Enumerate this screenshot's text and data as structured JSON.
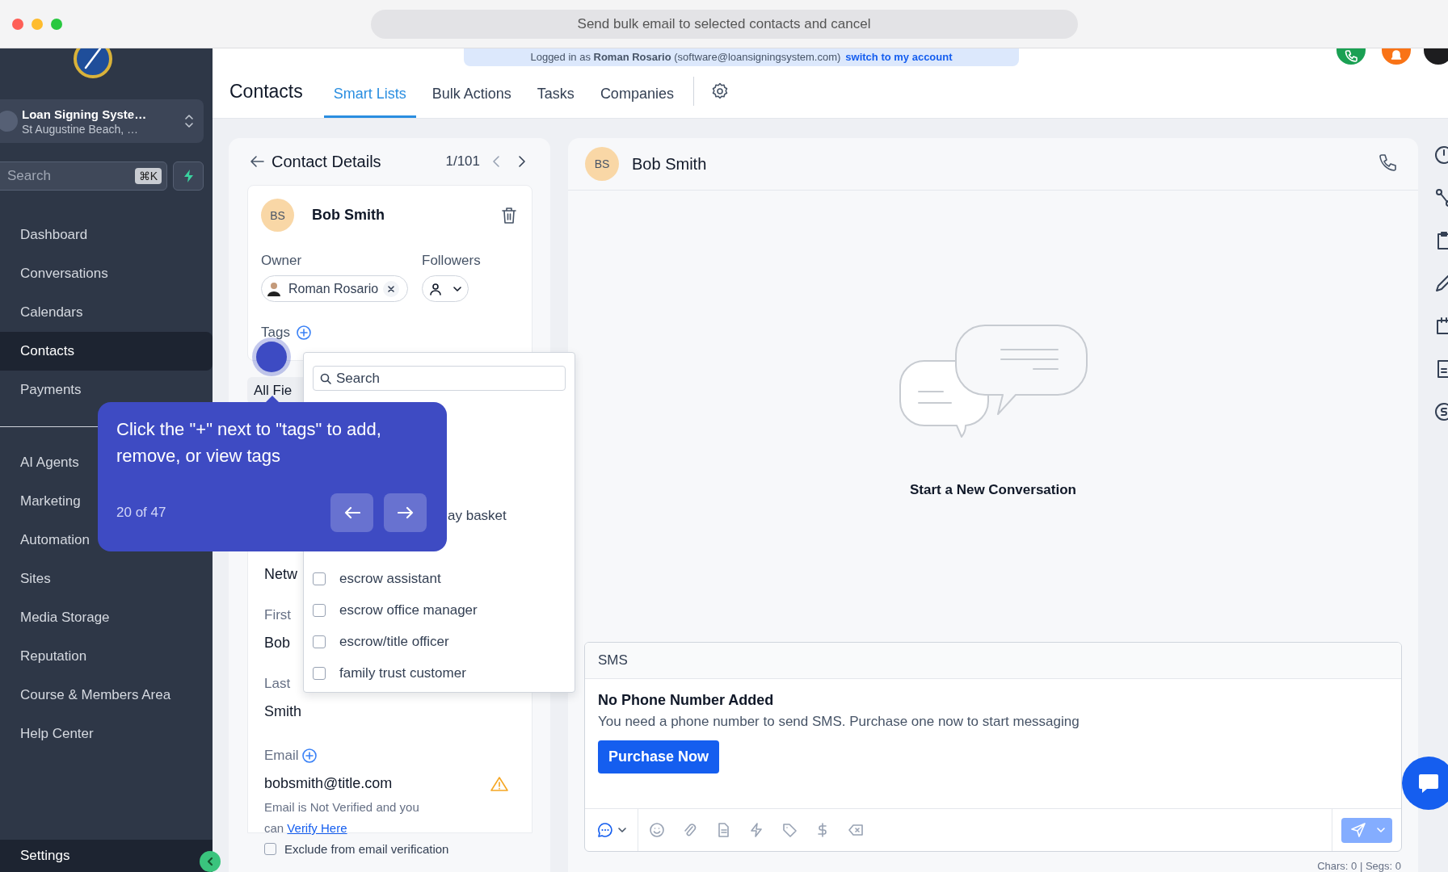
{
  "window": {
    "title": "Send bulk email to selected contacts and cancel"
  },
  "banner": {
    "text": "Logged in as **Roman Rosario** (software@loansigningsystem.com)",
    "link": "switch to my account"
  },
  "sidebar": {
    "account": {
      "name": "Loan Signing Syste…",
      "location": "St Augustine Beach, …"
    },
    "search": {
      "placeholder": "Search",
      "shortcut": "⌘K"
    },
    "nav": [
      {
        "label": "Dashboard",
        "selected": false
      },
      {
        "label": "Conversations",
        "selected": false
      },
      {
        "label": "Calendars",
        "selected": false
      },
      {
        "label": "Contacts",
        "selected": true
      },
      {
        "label": "Payments",
        "selected": false
      }
    ],
    "nav_secondary": [
      {
        "label": "AI Agents",
        "selected": false
      },
      {
        "label": "Marketing",
        "selected": false
      },
      {
        "label": "Automation",
        "selected": false
      },
      {
        "label": "Sites",
        "selected": false
      },
      {
        "label": "Media Storage",
        "selected": false
      },
      {
        "label": "Reputation",
        "selected": false
      },
      {
        "label": "Course & Members Area",
        "selected": false
      },
      {
        "label": "Help Center",
        "selected": false
      }
    ],
    "settings": "Settings"
  },
  "header": {
    "title": "Contacts",
    "tabs": [
      {
        "label": "Smart Lists",
        "selected": true
      },
      {
        "label": "Bulk Actions",
        "selected": false
      },
      {
        "label": "Tasks",
        "selected": false
      },
      {
        "label": "Companies",
        "selected": false
      }
    ]
  },
  "contact_panel": {
    "title": "Contact Details",
    "position": "1/101",
    "initials": "BS",
    "name": "Bob Smith",
    "owner_label": "Owner",
    "owner": "Roman Rosario",
    "followers_label": "Followers",
    "tags_label": "Tags",
    "fields_tab": "All Fie",
    "section": "Netw",
    "fields": [
      {
        "label": "First",
        "value": "Bob"
      },
      {
        "label": "Last",
        "value": "Smith"
      }
    ],
    "email_label": "Email",
    "email": "bobsmith@title.com",
    "email_note": "Email is Not Verified and you can",
    "verify_link": "Verify Here",
    "exclude": {
      "label": "Exclude from email verification",
      "checked": false
    }
  },
  "tag_dropdown": {
    "placeholder": "Search",
    "partial_item": "ay basket",
    "items": [
      {
        "label": "escrow assistant",
        "checked": false
      },
      {
        "label": "escrow office manager",
        "checked": false
      },
      {
        "label": "escrow/title officer",
        "checked": false
      },
      {
        "label": "family trust customer",
        "checked": false
      }
    ]
  },
  "tour": {
    "text": "Click the \"+\" next to \"tags\" to add, remove, or view tags",
    "step": "20 of 47"
  },
  "conversation": {
    "initials": "BS",
    "name": "Bob Smith",
    "empty_title": "Start a New Conversation",
    "sms": {
      "tab": "SMS",
      "title": "No Phone Number Added",
      "message": "You need a phone number to send SMS. Purchase one now to start messaging",
      "button": "Purchase Now",
      "counter": "Chars: 0 | Segs: 0"
    }
  }
}
